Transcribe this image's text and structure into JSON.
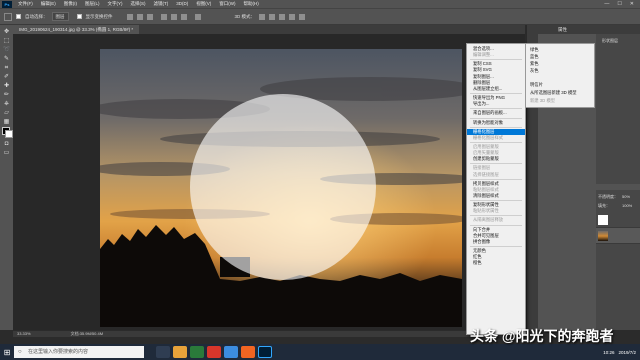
{
  "app": {
    "logo_text": "Ps"
  },
  "menubar": {
    "items": [
      "文件(F)",
      "编辑(E)",
      "图像(I)",
      "图层(L)",
      "文字(Y)",
      "选择(S)",
      "滤镜(T)",
      "3D(D)",
      "视图(V)",
      "窗口(W)",
      "帮助(H)"
    ],
    "window_buttons": [
      "—",
      "☐",
      "✕"
    ]
  },
  "options_bar": {
    "auto_select_label": "自动选择：",
    "auto_select_value": "图层",
    "show_transform_label": "显示变换控件",
    "mode_3d_label": "3D 模式："
  },
  "document_tab": {
    "title": "IMG_20190624_190314.jpg @ 33.3% (椭圆 1, RGB/8#) *"
  },
  "status_bar": {
    "zoom": "33.33%",
    "doc_info": "文档:35.9M/50.4M"
  },
  "context_menu": {
    "items": [
      {
        "label": "混合选项...",
        "disabled": false
      },
      {
        "label": "编辑调整...",
        "disabled": true
      },
      {
        "sep": true
      },
      {
        "label": "复制 CSS",
        "disabled": false
      },
      {
        "label": "复制 SVG",
        "disabled": false
      },
      {
        "label": "复制图层...",
        "disabled": false
      },
      {
        "label": "删除图层",
        "disabled": false
      },
      {
        "label": "从图层建立组...",
        "disabled": false
      },
      {
        "sep": true
      },
      {
        "label": "快速导出为 PNG",
        "disabled": false
      },
      {
        "label": "导出为...",
        "disabled": false
      },
      {
        "sep": true
      },
      {
        "label": "来自图层的画板...",
        "disabled": false
      },
      {
        "sep": true
      },
      {
        "label": "转换为智能对象",
        "disabled": false
      },
      {
        "sep": true
      },
      {
        "label": "栅格化图层",
        "disabled": false,
        "highlight": true
      },
      {
        "label": "栅格化图层样式",
        "disabled": true
      },
      {
        "sep": true
      },
      {
        "label": "启用图层蒙版",
        "disabled": true
      },
      {
        "label": "启用矢量蒙版",
        "disabled": true
      },
      {
        "label": "创建剪贴蒙版",
        "disabled": false
      },
      {
        "sep": true
      },
      {
        "label": "链接图层",
        "disabled": true
      },
      {
        "label": "选择链接图层",
        "disabled": true
      },
      {
        "sep": true
      },
      {
        "label": "拷贝图层样式",
        "disabled": false
      },
      {
        "label": "粘贴图层样式",
        "disabled": true
      },
      {
        "label": "清除图层样式",
        "disabled": false
      },
      {
        "sep": true
      },
      {
        "label": "复制形状属性",
        "disabled": false
      },
      {
        "label": "粘贴形状属性",
        "disabled": true
      },
      {
        "sep": true
      },
      {
        "label": "从隔离图层释放",
        "disabled": true
      },
      {
        "sep": true
      },
      {
        "label": "向下合并",
        "disabled": false
      },
      {
        "label": "合并可见图层",
        "disabled": false
      },
      {
        "label": "拼合图像",
        "disabled": false
      },
      {
        "sep": true
      },
      {
        "label": "无颜色",
        "disabled": false
      },
      {
        "label": "红色",
        "disabled": false
      },
      {
        "label": "橙色",
        "disabled": false
      }
    ]
  },
  "color_submenu": {
    "items": [
      {
        "label": "绿色",
        "disabled": false
      },
      {
        "label": "蓝色",
        "disabled": false
      },
      {
        "label": "紫色",
        "disabled": false
      },
      {
        "label": "灰色",
        "disabled": false
      },
      {
        "label": "明信片",
        "disabled": false
      },
      {
        "label": "从所选图层新建 3D 模型",
        "disabled": false
      },
      {
        "label": "新建 3D 模型",
        "disabled": true
      }
    ]
  },
  "properties_panel": {
    "tab": "属性",
    "label": "形状图层"
  },
  "layers_panel": {
    "opacity_label": "不透明度：",
    "opacity_value": "50%",
    "fill_label": "填充：",
    "fill_value": "100%"
  },
  "taskbar": {
    "search_placeholder": "在这里输入你要搜索的内容",
    "date": "2019/7/2",
    "time": "10:26"
  },
  "watermark": {
    "text": "头条 @阳光下的奔跑者"
  },
  "colors": {
    "accent": "#0078d7",
    "ps_blue": "#31a8ff",
    "panel_bg": "#535353"
  }
}
